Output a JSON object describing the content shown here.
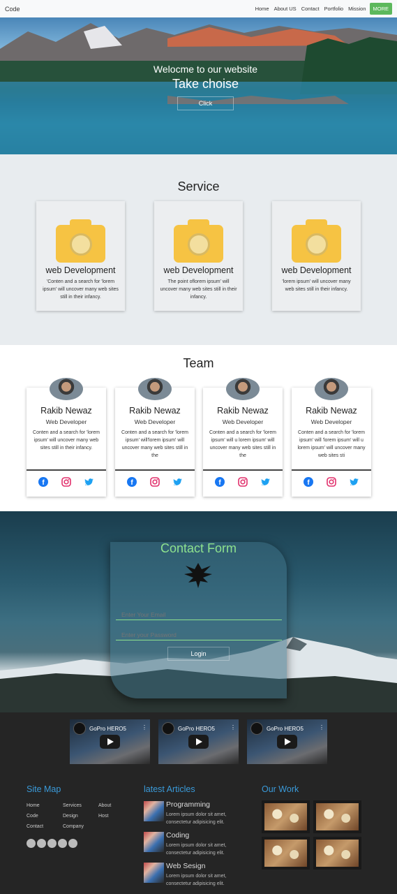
{
  "nav": {
    "brand": "Code",
    "links": [
      "Home",
      "About US",
      "Contact",
      "Portfolio",
      "Mission"
    ],
    "more": "MORE"
  },
  "hero": {
    "welcome": "Welocme to our website",
    "subtitle": "Take choise",
    "button": "Click"
  },
  "service": {
    "title": "Service",
    "cards": [
      {
        "icon": "camera-icon",
        "title": "web Development",
        "text": "'Conten and a search for 'lorem ipsum' will uncover many web sites still in their infancy."
      },
      {
        "icon": "camera-icon",
        "title": "web Development",
        "text": "The point oflorem ipsum' will uncover many web sites still in their infancy."
      },
      {
        "icon": "camera-icon",
        "title": "web Development",
        "text": "'lorem ipsum' will uncover many web sites still in their infancy."
      }
    ]
  },
  "team": {
    "title": "Team",
    "members": [
      {
        "name": "Rakib Newaz",
        "role": "Web Developer",
        "text": "Conten and a search for 'lorem ipsum' will uncover many web sites still in their infancy."
      },
      {
        "name": "Rakib Newaz",
        "role": "Web Developer",
        "text": "Conten and a search for 'lorem ipsum' will'lorem ipsum' will uncover many web sites still in the"
      },
      {
        "name": "Rakib Newaz",
        "role": "Web Developer",
        "text": "Conten and a search for 'lorem ipsum' will u lorem ipsum' will uncover many web sites still in the"
      },
      {
        "name": "Rakib Newaz",
        "role": "Web Developer",
        "text": "Conten and a search for 'lorem ipsum' will 'lorem ipsum' will u lorem ipsum' will uncover many web sites sti"
      }
    ],
    "social_icons": [
      "facebook-icon",
      "instagram-icon",
      "twitter-icon"
    ],
    "colors": {
      "facebook": "#1877f2",
      "instagram": "#e1306c",
      "twitter": "#1da1f2"
    }
  },
  "contact": {
    "title": "Contact Form",
    "email_placeholder": "Enter Your Email",
    "password_placeholder": "Enter your Password",
    "button": "Login"
  },
  "videos": [
    {
      "title": "GoPro HERO5"
    },
    {
      "title": "GoPro HERO5"
    },
    {
      "title": "GoPro HERO5"
    }
  ],
  "footer": {
    "site_map": {
      "title": "Site Map",
      "columns": [
        [
          "Home",
          "Code",
          "Contact"
        ],
        [
          "Services",
          "Design",
          "Company"
        ],
        [
          "About",
          "Host"
        ]
      ],
      "icons": [
        "facebook-icon",
        "instagram-icon",
        "twitter-icon",
        "snapchat-icon",
        "skype-icon"
      ]
    },
    "articles": {
      "title": "latest Articles",
      "items": [
        {
          "title": "Programming",
          "text": "Lorem ipsum dolor sit amet, consectetur adipisicing elit."
        },
        {
          "title": "Coding",
          "text": "Lorem ipsum dolor sit amet, consectetur adipisicing elit."
        },
        {
          "title": "Web Sesign",
          "text": "Lorem ipsum dolor sit amet, consectetur adipisicing elit."
        }
      ]
    },
    "work": {
      "title": "Our Work"
    }
  },
  "theme": {
    "accent_green": "#5cb85c",
    "contact_title_green": "#8ee28e",
    "footer_heading_blue": "#3a9ad9",
    "camera_yellow": "#f6c343"
  }
}
